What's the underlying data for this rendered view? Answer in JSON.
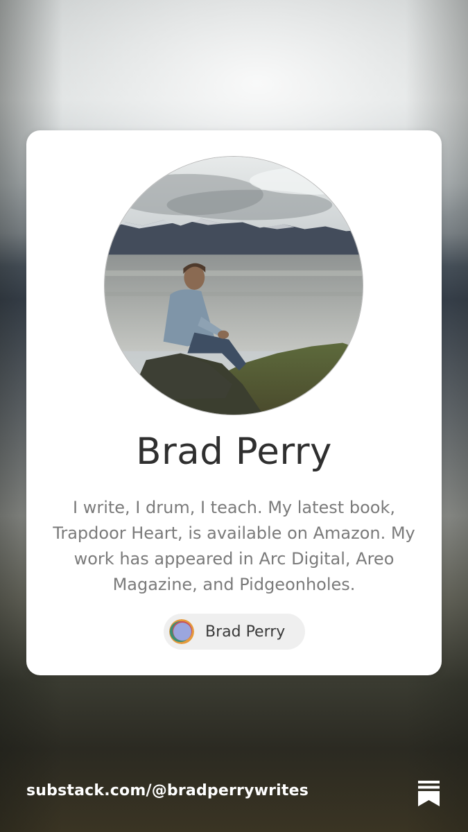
{
  "profile": {
    "name": "Brad Perry",
    "bio": "I write, I drum, I teach. My latest book, Trapdoor Heart, is available on Amazon. My work has appeared in Arc Digital, Areo Magazine, and Pidgeonholes.",
    "publication_chip_label": "Brad Perry"
  },
  "footer": {
    "url": "substack.com/@bradperrywrites",
    "logo_icon": "substack-logo-icon"
  },
  "colors": {
    "card_background": "#ffffff",
    "name_text": "#2f2f2f",
    "bio_text": "#7a7a7a",
    "chip_background": "#efefef",
    "footer_text": "#ffffff"
  }
}
